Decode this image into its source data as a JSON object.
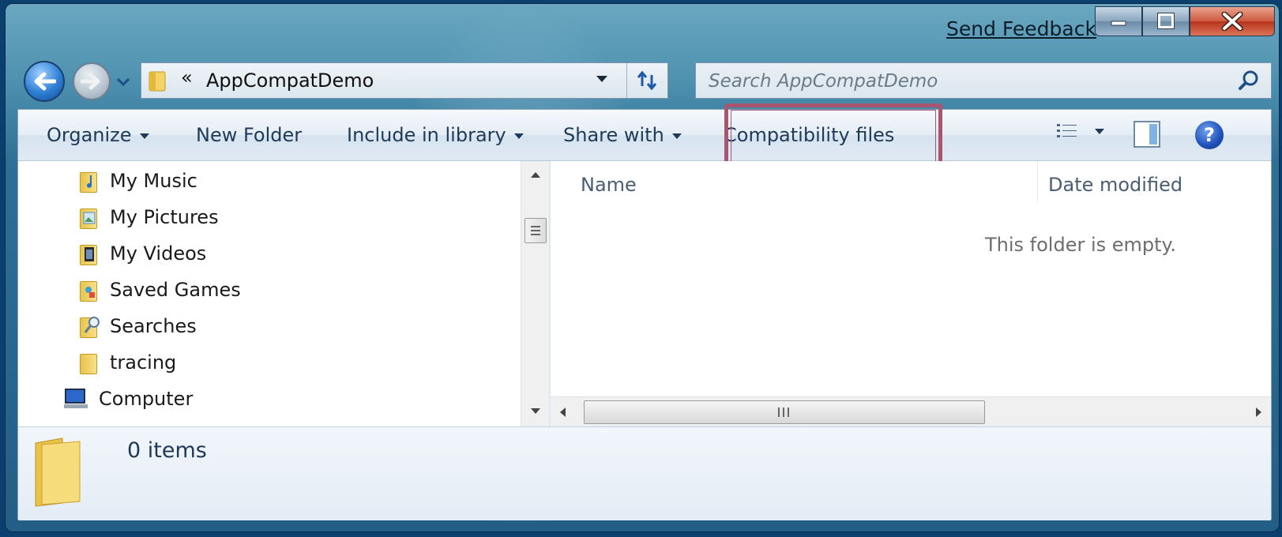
{
  "window": {
    "send_feedback": "Send Feedback"
  },
  "address_bar": {
    "chevron": "«",
    "path": "AppCompatDemo"
  },
  "search": {
    "placeholder": "Search AppCompatDemo"
  },
  "command_bar": {
    "organize": "Organize",
    "new_folder": "New Folder",
    "include_in_library": "Include in library",
    "share_with": "Share with",
    "compatibility_files": "Compatibility files",
    "help": "?"
  },
  "nav_pane": {
    "items": [
      {
        "label": "My Music",
        "icon": "music-folder-icon"
      },
      {
        "label": "My Pictures",
        "icon": "pictures-folder-icon"
      },
      {
        "label": "My Videos",
        "icon": "videos-folder-icon"
      },
      {
        "label": "Saved Games",
        "icon": "saved-games-folder-icon"
      },
      {
        "label": "Searches",
        "icon": "searches-folder-icon"
      },
      {
        "label": "tracing",
        "icon": "folder-icon"
      },
      {
        "label": "Computer",
        "icon": "computer-icon"
      }
    ]
  },
  "content": {
    "columns": [
      "Name",
      "Date modified"
    ],
    "empty_message": "This folder is empty."
  },
  "details_pane": {
    "item_count": "0 items"
  },
  "colors": {
    "highlight_border": "#a8566f",
    "command_text": "#1e3a57"
  }
}
